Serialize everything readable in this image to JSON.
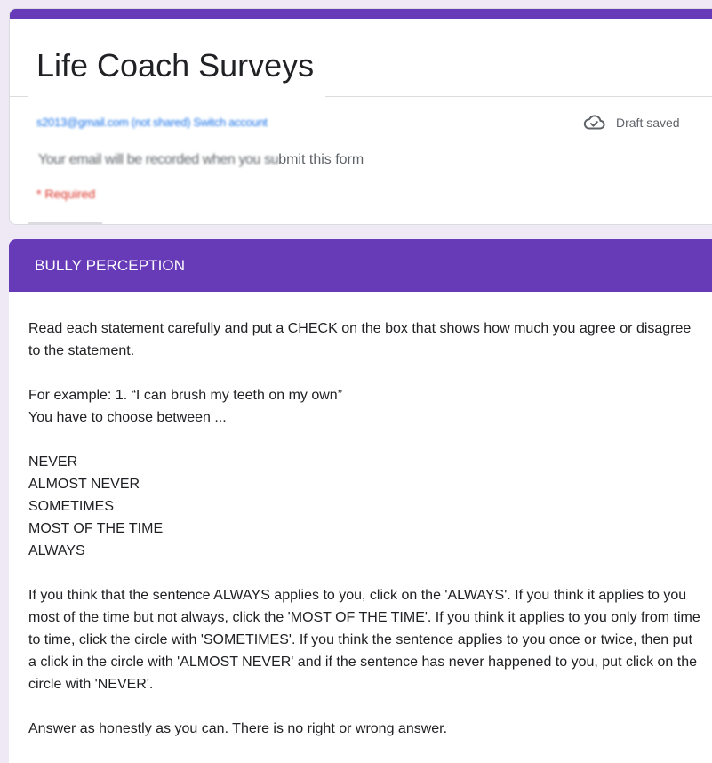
{
  "form": {
    "title": "Life Coach Surveys",
    "account_text": "s2013@gmail.com (not shared) Switch account",
    "record_text_blurred": "Your email will be recorded when you su",
    "record_text_clear": "bmit this form",
    "required_text": "* Required",
    "draft_status": "Draft saved"
  },
  "section": {
    "title": "BULLY PERCEPTION",
    "intro": "Read each statement carefully and put a CHECK on the box that shows how much you agree or disagree to the statement.",
    "example_line1": "For example: 1. “I can brush my teeth on my own”",
    "example_line2": "You have to choose between ...",
    "options": [
      "NEVER",
      "ALMOST NEVER",
      "SOMETIMES",
      "MOST OF THE TIME",
      "ALWAYS"
    ],
    "instructions": "If you think that the sentence ALWAYS applies to you, click on the 'ALWAYS'. If you think it applies to you most of the time but not always, click the 'MOST OF THE TIME'. If you think it applies to you only from time to time, click the circle with 'SOMETIMES'. If you think the sentence applies to you once or twice, then put a click in the circle  with 'ALMOST NEVER' and if the sentence has never happened to you, put click on the circle with 'NEVER'.",
    "closing": "Answer as honestly as you can. There is no right or wrong answer."
  },
  "colors": {
    "accent": "#673ab7",
    "background": "#efe9f6",
    "link": "#1a73e8",
    "required": "#d93025"
  },
  "icons": {
    "draft": "cloud-done-icon"
  }
}
